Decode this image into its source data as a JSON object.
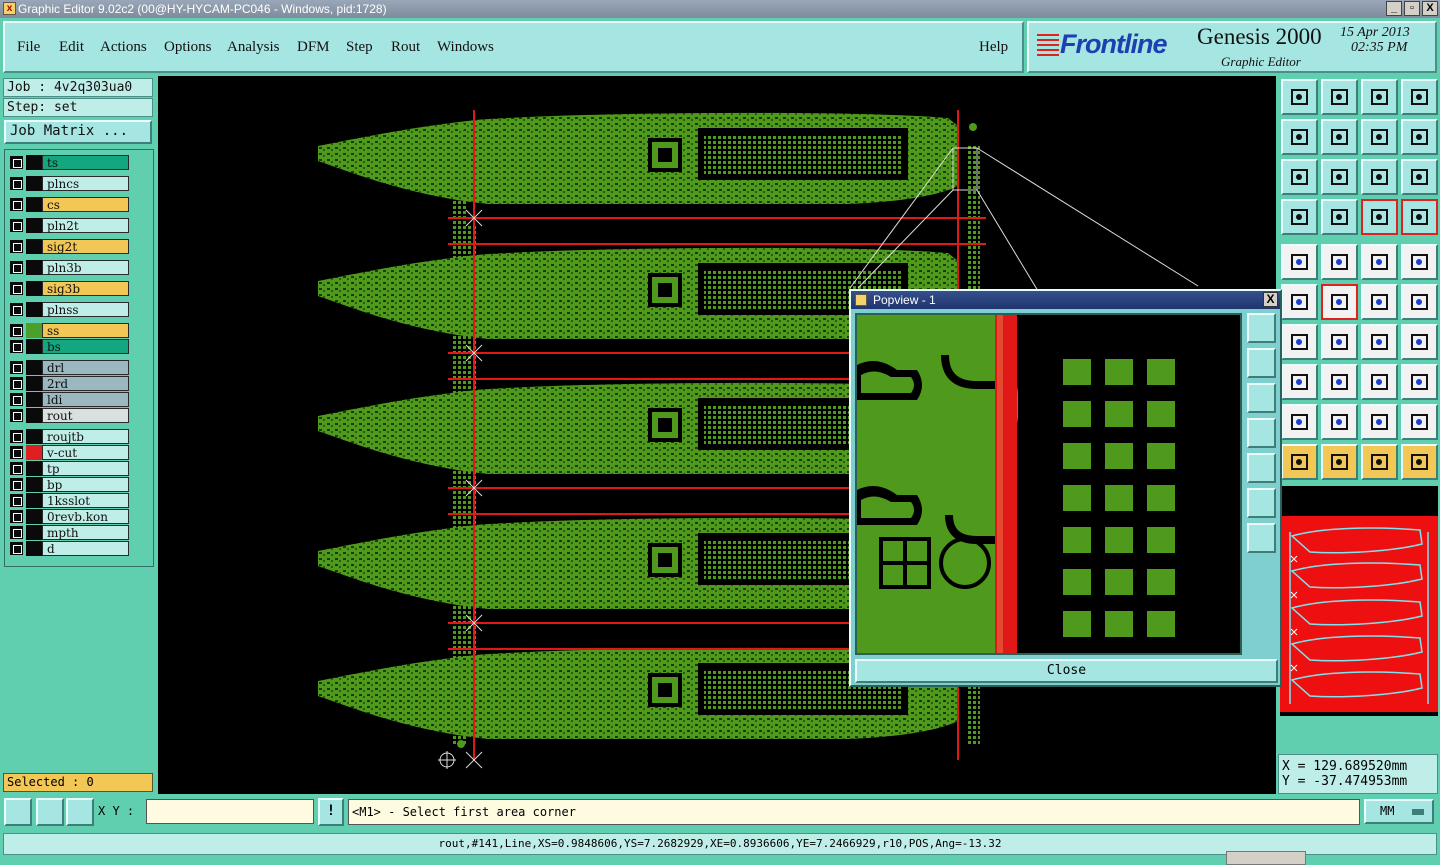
{
  "window": {
    "title": "Graphic Editor 9.02c2 (00@HY-HYCAM-PC046 - Windows, pid:1728)",
    "buttons": [
      "_",
      "▫",
      "X"
    ]
  },
  "menu": [
    "File",
    "Edit",
    "Actions",
    "Options",
    "Analysis",
    "DFM",
    "Step",
    "Rout",
    "Windows"
  ],
  "help_label": "Help",
  "brand": {
    "logo": "Frontline",
    "product": "Genesis 2000",
    "subtitle": "Graphic Editor",
    "date": "15 Apr 2013",
    "time": "02:35 PM"
  },
  "job": {
    "job_line": "Job : 4v2q303ua0",
    "step_line": "Step: set",
    "job_matrix_label": "Job Matrix ..."
  },
  "layers": [
    {
      "name": "ts",
      "bg": "#14a67e",
      "swatch": "#0a0a0a"
    },
    {
      "name": "plncs",
      "bg": "#bfeee8",
      "swatch": "#0a0a0a"
    },
    {
      "name": "cs",
      "bg": "#f3c755",
      "swatch": "#0a0a0a"
    },
    {
      "name": "pln2t",
      "bg": "#bfeee8",
      "swatch": "#0a0a0a"
    },
    {
      "name": "sig2t",
      "bg": "#f3c755",
      "swatch": "#0a0a0a"
    },
    {
      "name": "pln3b",
      "bg": "#bfeee8",
      "swatch": "#0a0a0a"
    },
    {
      "name": "sig3b",
      "bg": "#f3c755",
      "swatch": "#0a0a0a"
    },
    {
      "name": "plnss",
      "bg": "#bfeee8",
      "swatch": "#0a0a0a"
    },
    {
      "name": "ss",
      "bg": "#f3c755",
      "swatch": "#4aa02a"
    },
    {
      "name": "bs",
      "bg": "#14a67e",
      "swatch": "#0a0a0a"
    },
    {
      "name": "drl",
      "bg": "#9bb8c0",
      "swatch": "#0a0a0a"
    },
    {
      "name": "2rd",
      "bg": "#9bb8c0",
      "swatch": "#0a0a0a"
    },
    {
      "name": "ldi",
      "bg": "#9bb8c0",
      "swatch": "#0a0a0a"
    },
    {
      "name": "rout",
      "bg": "#d8e0e0",
      "swatch": "#0a0a0a"
    },
    {
      "name": "roujtb",
      "bg": "#bfeee8",
      "swatch": "#0a0a0a"
    },
    {
      "name": "v-cut",
      "bg": "#bfeee8",
      "swatch": "#e02020"
    },
    {
      "name": "tp",
      "bg": "#bfeee8",
      "swatch": "#0a0a0a"
    },
    {
      "name": "bp",
      "bg": "#bfeee8",
      "swatch": "#0a0a0a"
    },
    {
      "name": "1ksslot",
      "bg": "#bfeee8",
      "swatch": "#0a0a0a"
    },
    {
      "name": "0revb.kon",
      "bg": "#bfeee8",
      "swatch": "#0a0a0a"
    },
    {
      "name": "mpth",
      "bg": "#bfeee8",
      "swatch": "#0a0a0a"
    },
    {
      "name": "d",
      "bg": "#bfeee8",
      "swatch": "#0a0a0a"
    }
  ],
  "selected_label": "Selected : 0",
  "popview": {
    "title": "Popview - 1",
    "close_label": "Close",
    "close_x": "X"
  },
  "coords": {
    "x": "X = 129.689520mm",
    "y": "Y = -37.474953mm"
  },
  "bottom": {
    "xy_label": "X Y :",
    "xy_value": "",
    "alert": "!",
    "prompt": "<M1> - Select first area corner",
    "units": "MM"
  },
  "status_line": "rout,#141,Line,XS=0.9848606,YS=7.2682929,XE=0.8936606,YE=7.2466929,r10,POS,Ang=-13.32",
  "colors": {
    "board": "#4f9a1c",
    "rout_line": "#e01818",
    "background": "#5fcfb0"
  }
}
